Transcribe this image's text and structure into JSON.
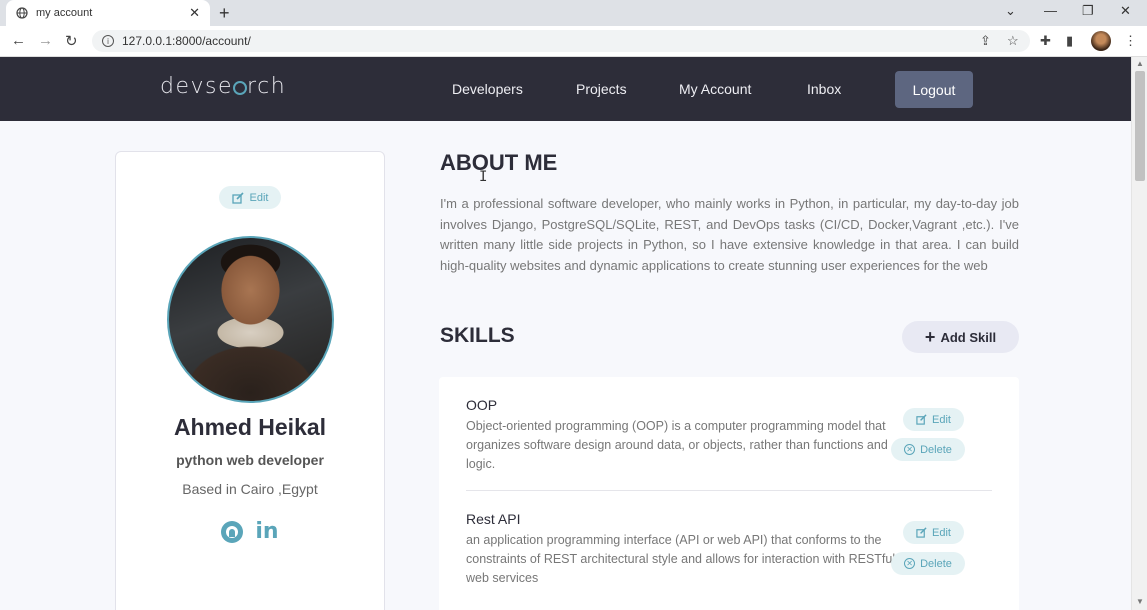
{
  "browser": {
    "tab_title": "my account",
    "url": "127.0.0.1:8000/account/"
  },
  "nav": {
    "logo": "devsearch",
    "links": [
      "Developers",
      "Projects",
      "My Account",
      "Inbox"
    ],
    "logout": "Logout"
  },
  "profile": {
    "edit_label": "Edit",
    "name": "Ahmed Heikal",
    "title": "python web developer",
    "location": "Based in Cairo ,Egypt",
    "social": [
      "github-icon",
      "linkedin-icon"
    ]
  },
  "about": {
    "heading": "ABOUT ME",
    "text": "I'm a professional software developer, who mainly works in Python, in particular, my day-to-day job involves Django, PostgreSQL/SQLite, REST, and DevOps tasks (CI/CD, Docker,Vagrant ,etc.). I've written many little side projects in Python, so I have extensive knowledge in that area. I can build high-quality websites and dynamic applications to create stunning user experiences for the web"
  },
  "skills": {
    "heading": "SKILLS",
    "add_label": "Add Skill",
    "edit_label": "Edit",
    "delete_label": "Delete",
    "items": [
      {
        "name": "OOP",
        "description": "Object-oriented programming (OOP) is a computer programming model that organizes software design around data, or objects, rather than functions and logic."
      },
      {
        "name": "Rest API",
        "description": "an application programming interface (API or web API) that conforms to the constraints of REST architectural style and allows for interaction with RESTful web services"
      }
    ]
  },
  "colors": {
    "nav_bg": "#2d2d39",
    "accent": "#5aa5b9",
    "logout_bg": "#5d6680",
    "page_bg": "#f7f8fc"
  }
}
